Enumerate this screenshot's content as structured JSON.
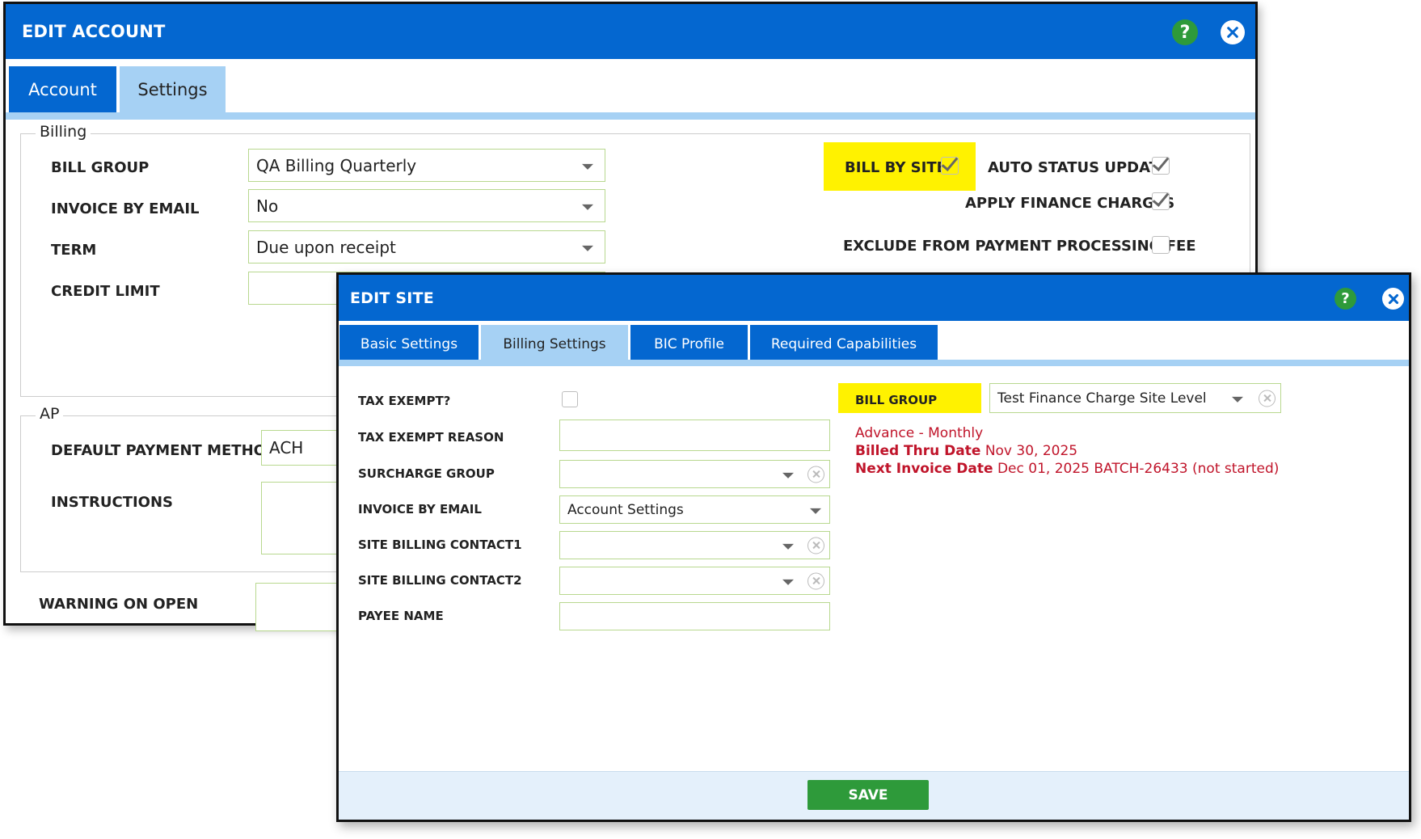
{
  "edit_account": {
    "title": "EDIT ACCOUNT",
    "help_symbol": "?",
    "tabs": [
      {
        "label": "Account",
        "active": false
      },
      {
        "label": "Settings",
        "active": true
      }
    ],
    "billing": {
      "legend": "Billing",
      "bill_group_label": "BILL GROUP",
      "bill_group_value": "QA Billing Quarterly",
      "invoice_by_email_label": "INVOICE BY EMAIL",
      "invoice_by_email_value": "No",
      "term_label": "TERM",
      "term_value": "Due upon receipt",
      "credit_limit_label": "CREDIT LIMIT",
      "credit_limit_value": "",
      "bill_by_site_label": "BILL BY SITE",
      "bill_by_site_checked": true,
      "auto_status_update_label": "AUTO STATUS UPDATE",
      "auto_status_update_checked": true,
      "apply_finance_charges_label": "APPLY FINANCE CHARGES",
      "apply_finance_charges_checked": true,
      "exclude_fee_label": "EXCLUDE FROM PAYMENT PROCESSING FEE",
      "exclude_fee_checked": false
    },
    "ap": {
      "legend": "AP",
      "default_payment_method_label": "DEFAULT PAYMENT METHOD",
      "default_payment_method_value": "ACH",
      "instructions_label": "INSTRUCTIONS"
    },
    "warning_on_open_label": "WARNING ON OPEN"
  },
  "edit_site": {
    "title": "EDIT SITE",
    "help_symbol": "?",
    "tabs": [
      {
        "label": "Basic Settings",
        "active": false
      },
      {
        "label": "Billing Settings",
        "active": true
      },
      {
        "label": "BIC Profile",
        "active": false
      },
      {
        "label": "Required Capabilities",
        "active": false
      }
    ],
    "fields": {
      "tax_exempt_label": "TAX EXEMPT?",
      "tax_exempt_checked": false,
      "tax_exempt_reason_label": "TAX EXEMPT REASON",
      "tax_exempt_reason_value": "",
      "surcharge_group_label": "SURCHARGE GROUP",
      "surcharge_group_value": "",
      "invoice_by_email_label": "INVOICE BY EMAIL",
      "invoice_by_email_value": "Account Settings",
      "site_billing_contact1_label": "SITE BILLING CONTACT1",
      "site_billing_contact1_value": "",
      "site_billing_contact2_label": "SITE BILLING CONTACT2",
      "site_billing_contact2_value": "",
      "payee_name_label": "PAYEE NAME",
      "payee_name_value": ""
    },
    "bill_group": {
      "label": "BILL GROUP",
      "value": "Test Finance Charge Site Level"
    },
    "billing_info": {
      "cycle": "Advance - Monthly",
      "billed_thru_label": "Billed Thru Date",
      "billed_thru_value": "Nov 30, 2025",
      "next_invoice_label": "Next Invoice Date",
      "next_invoice_value": "Dec 01, 2025 BATCH-26433 (not started)"
    },
    "save_label": "SAVE"
  },
  "colors": {
    "title_bar": "#0467d0",
    "tab_light": "#a6d1f4",
    "highlight": "#fff200",
    "help_green": "#2e9a3a",
    "save_green": "#2e9a3a",
    "info_red": "#c0142a",
    "input_border": "#b8d88f"
  },
  "icons": {
    "help": "help-icon",
    "close": "close-icon",
    "dropdown": "chevron-down-icon",
    "clear": "clear-icon",
    "check": "checkmark-icon"
  }
}
